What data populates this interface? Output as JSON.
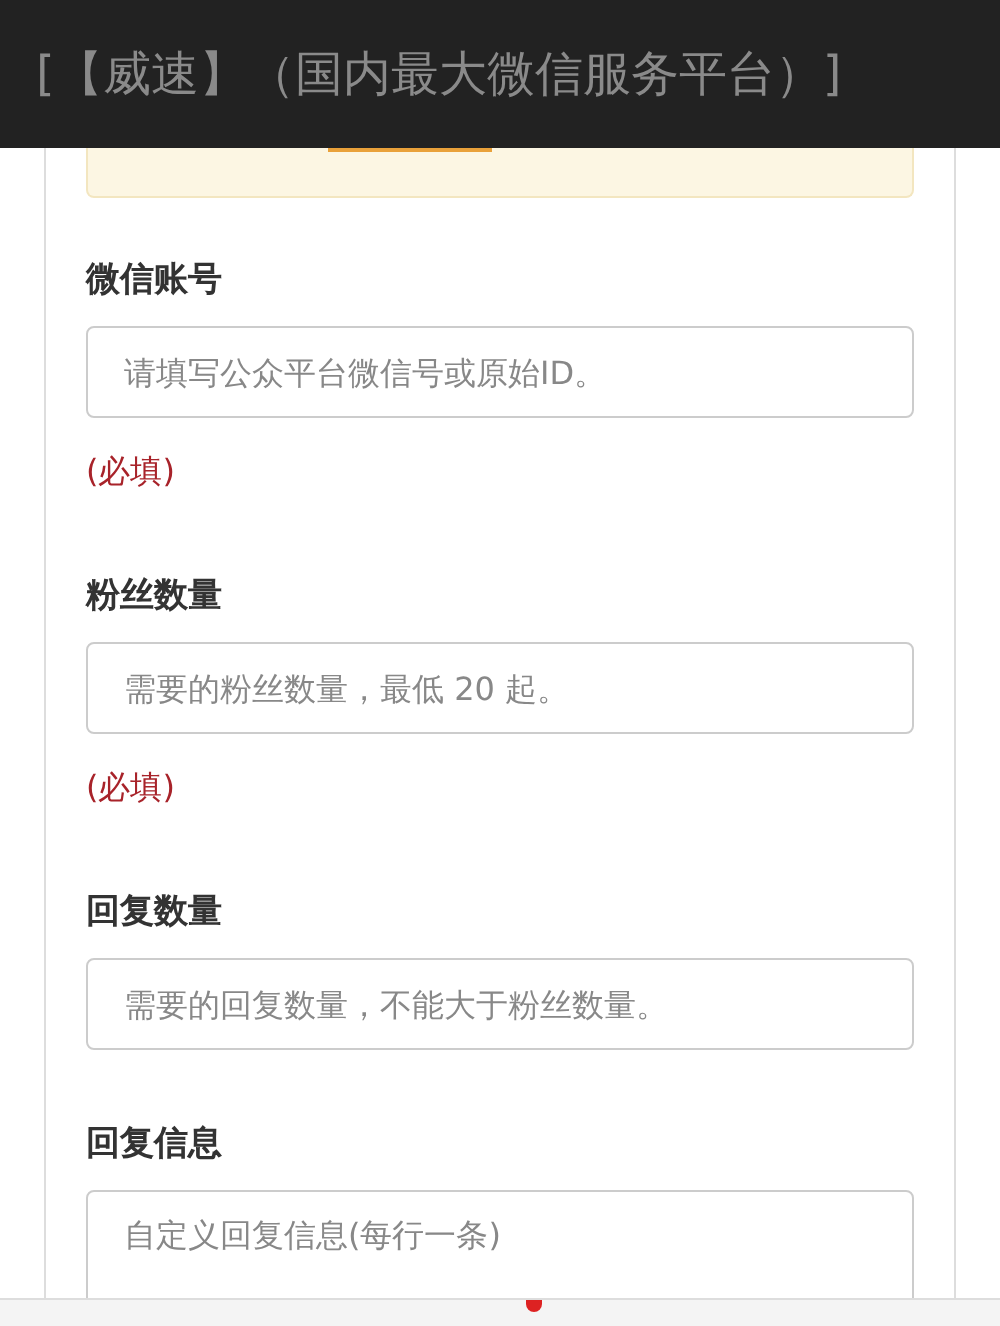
{
  "header": {
    "title": "[【威速】（国内最大微信服务平台）]"
  },
  "fields": [
    {
      "kind": "input",
      "label": "微信账号",
      "placeholder": "请填写公众平台微信号或原始ID。",
      "note": "(必填)"
    },
    {
      "kind": "input",
      "label": "粉丝数量",
      "placeholder": "需要的粉丝数量，最低 20 起。",
      "note": "(必填)"
    },
    {
      "kind": "input",
      "label": "回复数量",
      "placeholder": "需要的回复数量，不能大于粉丝数量。"
    },
    {
      "kind": "textarea",
      "label": "回复信息",
      "placeholder": "自定义回复信息(每行一条)"
    }
  ]
}
